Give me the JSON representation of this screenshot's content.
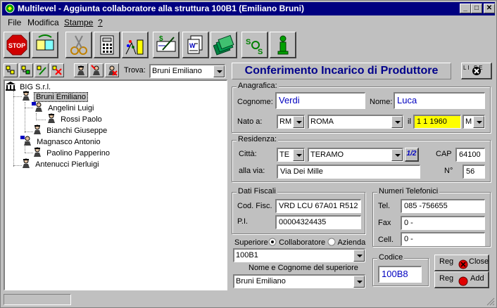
{
  "window": {
    "title": "Multilevel - Aggiunta collaboratore alla struttura 100B1 (Emiliano Bruni)"
  },
  "titlebar_buttons": {
    "minimize": "_",
    "maximize": "□",
    "close": "✕"
  },
  "menu": {
    "items": [
      "File",
      "Modifica",
      "Stampe",
      "?"
    ]
  },
  "toolbar": {
    "icons": [
      "stop-icon",
      "link-icon",
      "scissors-icon",
      "calculator-icon",
      "chemistry-icon",
      "check-icon",
      "document-icon",
      "money-icon",
      "sos-icon",
      "info-icon"
    ]
  },
  "tree_toolbar": {
    "icons": [
      "tree-expand-icon",
      "tree-collapse-icon",
      "tree-edit-icon",
      "tree-delete-icon",
      "agent-icon",
      "agent-add-icon",
      "agent-remove-icon"
    ],
    "find_label": "Trova:",
    "find_value": "Bruni Emiliano"
  },
  "tree": {
    "root": "BIG S.r.l.",
    "nodes": [
      {
        "label": "Bruni Emiliano",
        "selected": true
      },
      {
        "label": "Angelini Luigi"
      },
      {
        "label": "Rossi Paolo"
      },
      {
        "label": "Bianchi Giuseppe"
      },
      {
        "label": "Magnasco Antonio"
      },
      {
        "label": "Paolino Papperino"
      },
      {
        "label": "Antenucci Pierluigi"
      }
    ]
  },
  "form": {
    "header": "Conferimento Incarico di Produttore",
    "close_icon_label": "LI SE",
    "anagrafica": {
      "title": "Anagrafica:",
      "cognome_label": "Cognome:",
      "cognome": "Verdi",
      "nome_label": "Nome:",
      "nome": "Luca",
      "nato_label": "Nato a:",
      "provincia": "RM",
      "comune": "ROMA",
      "il_label": "il",
      "data_nascita": "1 1 1960",
      "sesso": "M"
    },
    "residenza": {
      "title": "Residenza:",
      "citta_label": "Città:",
      "provincia": "TE",
      "comune": "TERAMO",
      "half_btn": "1/2",
      "cap_label": "CAP",
      "cap": "64100",
      "via_label": "alla via:",
      "via": "Via Dei Mille",
      "numero_label": "N°",
      "numero": "56"
    },
    "fiscali": {
      "title": "Dati Fiscali",
      "cf_label": "Cod. Fisc.",
      "cf": "VRD LCU 67A01 R512",
      "pi_label": "P.I.",
      "pi": "00004324435"
    },
    "telefoni": {
      "title": "Numeri Telefonici",
      "tel_label": "Tel.",
      "tel": "085 -756655",
      "fax_label": "Fax",
      "fax": "0  -",
      "cell_label": "Cell.",
      "cell": "0  -"
    },
    "superiore": {
      "label": "Superiore",
      "option_collab": "Collaboratore",
      "option_azienda": "Azienda",
      "codice": "100B1",
      "nome_label": "Nome e Cognome del superiore",
      "nome": "Bruni Emiliano"
    },
    "codice": {
      "label": "Codice",
      "value": "100B8"
    },
    "buttons": {
      "reg_close_a": "Reg",
      "reg_close_b": "Close",
      "reg_add_a": "Reg",
      "reg_add_b": "Add"
    }
  },
  "colors": {
    "title_bg": "#000080",
    "highlight": "#ffff00",
    "form_text": "#0000c0",
    "header_text": "#00008b"
  }
}
